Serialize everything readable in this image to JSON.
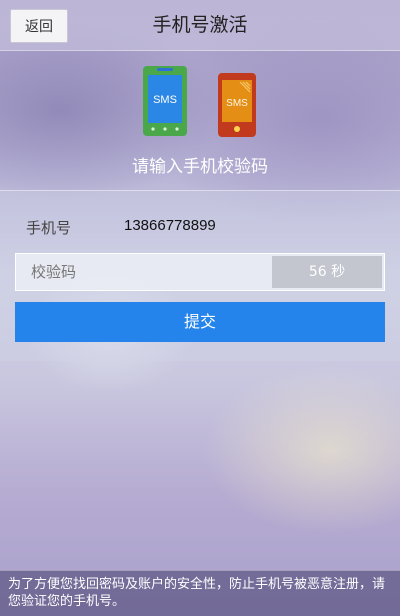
{
  "header": {
    "back_label": "返回",
    "title": "手机号激活"
  },
  "hero": {
    "left_phone_icon": "phone-sms-icon",
    "left_phone_screen_text": "SMS",
    "left_phone_color": "#4aa84a",
    "right_phone_icon": "phone-sms-received-icon",
    "right_phone_screen_text": "SMS",
    "right_phone_color": "#c13a1d",
    "prompt": "请输入手机校验码"
  },
  "form": {
    "phone_label": "手机号",
    "phone_value": "13866778899",
    "code_placeholder": "校验码",
    "countdown": "56 秒",
    "submit_label": "提交"
  },
  "footer": {
    "notice": "为了方便您找回密码及账户的安全性，防止手机号被恶意注册，请您验证您的手机号。"
  },
  "colors": {
    "accent": "#2484ec",
    "countdown_bg": "#c4c6cf"
  }
}
